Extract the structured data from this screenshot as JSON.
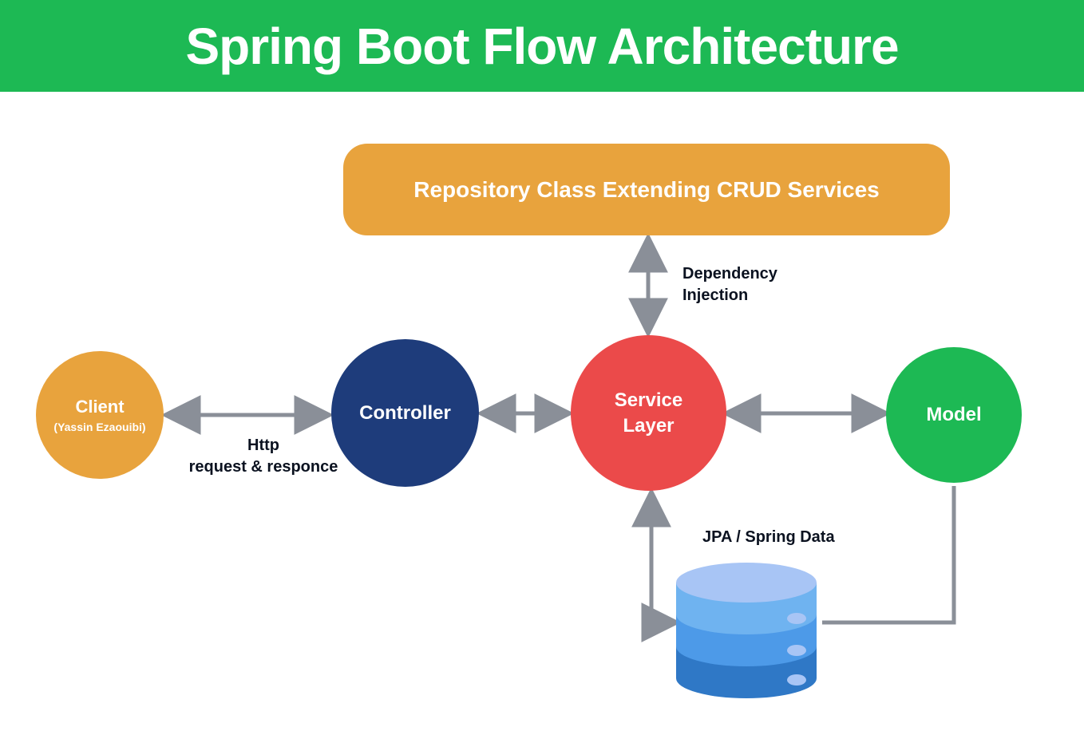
{
  "header": {
    "title": "Spring Boot Flow Architecture"
  },
  "nodes": {
    "client": {
      "label": "Client",
      "sublabel": "(Yassin Ezaouibi)"
    },
    "controller": {
      "label": "Controller"
    },
    "service": {
      "label_line1": "Service",
      "label_line2": "Layer"
    },
    "model": {
      "label": "Model"
    },
    "repository": {
      "label": "Repository Class Extending CRUD Services"
    }
  },
  "labels": {
    "http": "Http\nrequest & responce",
    "dependency_injection": "Dependency\nInjection",
    "jpa": "JPA / Spring Data"
  },
  "colors": {
    "green": "#1DB954",
    "orange": "#E8A33D",
    "navy": "#1E3C7B",
    "red": "#EB4A4A",
    "arrow": "#8A8F98",
    "db_light": "#A8C5F5",
    "db_mid": "#4D9AE8",
    "db_dark": "#2F78C6"
  }
}
